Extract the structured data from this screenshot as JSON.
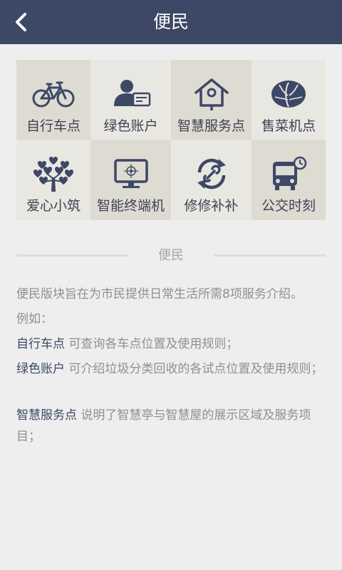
{
  "header": {
    "title": "便民",
    "back_icon": "chevron-left-icon"
  },
  "colors": {
    "header_bg": "#3c4865",
    "tile_dark": "#dedbd3",
    "tile_light": "#e9e7e2",
    "icon": "#3c4865"
  },
  "tiles": [
    {
      "label": "自行车点",
      "icon": "bicycle-icon"
    },
    {
      "label": "绿色账户",
      "icon": "user-card-icon"
    },
    {
      "label": "智慧服务点",
      "icon": "birdhouse-icon"
    },
    {
      "label": "售菜机点",
      "icon": "cabbage-icon"
    },
    {
      "label": "爱心小筑",
      "icon": "heart-tree-icon"
    },
    {
      "label": "智能终端机",
      "icon": "terminal-icon"
    },
    {
      "label": "修修补补",
      "icon": "wrench-cycle-icon"
    },
    {
      "label": "公交时刻",
      "icon": "bus-clock-icon"
    }
  ],
  "section": {
    "title": "便民"
  },
  "description": {
    "intro": "便民版块旨在为市民提供日常生活所需8项服务介绍。",
    "example": "例如：",
    "items": [
      {
        "name": "自行车点",
        "text": "可查询各车点位置及使用规则；"
      },
      {
        "name": "绿色账户",
        "text": "可介绍垃圾分类回收的各试点位置及使用规则；"
      },
      {
        "name": "智慧服务点",
        "text": "说明了智慧亭与智慧屋的展示区域及服务项目；"
      }
    ]
  }
}
